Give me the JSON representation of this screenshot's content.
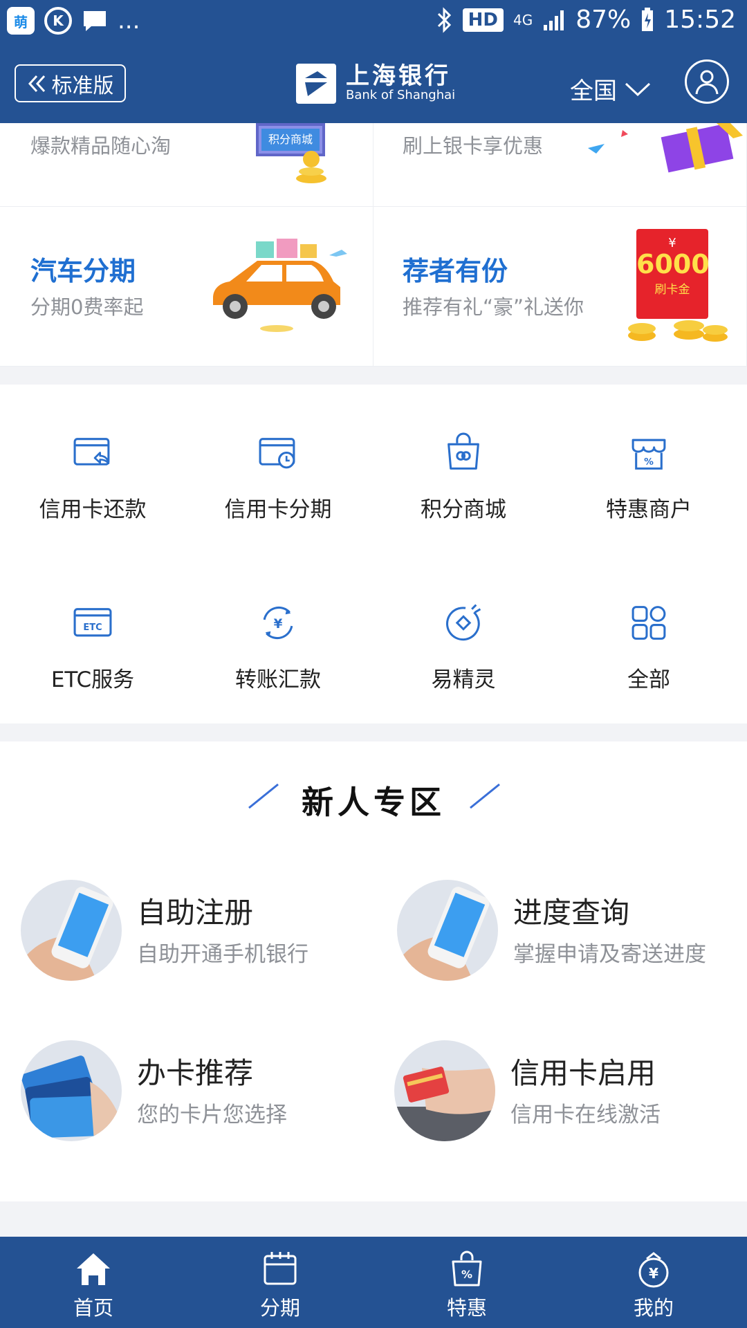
{
  "status_bar": {
    "app_badge": "萌",
    "k_icon": "K",
    "dots": "...",
    "hd": "HD",
    "network": "4G",
    "battery": "87%",
    "time": "15:52"
  },
  "header": {
    "back_label": "标准版",
    "logo_cn": "上海银行",
    "logo_en": "Bank of Shanghai",
    "region": "全国"
  },
  "promos": [
    {
      "title": "",
      "subtitle": "爆款精品随心淘",
      "image_label": "积分商城"
    },
    {
      "title": "",
      "subtitle": "刷上银卡享优惠"
    },
    {
      "title": "汽车分期",
      "subtitle": "分期0费率起"
    },
    {
      "title": "荐者有份",
      "subtitle": "推荐有礼“豪”礼送你",
      "ticket_amount": "6000",
      "ticket_label": "刷卡金",
      "ticket_currency": "¥"
    }
  ],
  "services": [
    {
      "label": "信用卡还款",
      "icon": "card-return-icon"
    },
    {
      "label": "信用卡分期",
      "icon": "card-clock-icon"
    },
    {
      "label": "积分商城",
      "icon": "shopping-bag-icon"
    },
    {
      "label": "特惠商户",
      "icon": "discount-shop-icon"
    },
    {
      "label": "ETC服务",
      "icon": "etc-icon"
    },
    {
      "label": "转账汇款",
      "icon": "transfer-icon"
    },
    {
      "label": "易精灵",
      "icon": "genie-icon"
    },
    {
      "label": "全部",
      "icon": "grid-icon"
    }
  ],
  "new_user_zone": {
    "title": "新人专区",
    "items": [
      {
        "title": "自助注册",
        "subtitle": "自助开通手机银行"
      },
      {
        "title": "进度查询",
        "subtitle": "掌握申请及寄送进度"
      },
      {
        "title": "办卡推荐",
        "subtitle": "您的卡片您选择"
      },
      {
        "title": "信用卡启用",
        "subtitle": "信用卡在线激活"
      }
    ]
  },
  "tabs": [
    {
      "label": "首页",
      "icon": "home-icon"
    },
    {
      "label": "分期",
      "icon": "calendar-icon"
    },
    {
      "label": "特惠",
      "icon": "discount-bag-icon"
    },
    {
      "label": "我的",
      "icon": "wallet-icon"
    }
  ],
  "colors": {
    "brand": "#245293",
    "accent": "#1f6fd1",
    "icon_blue": "#2a6fcc"
  }
}
